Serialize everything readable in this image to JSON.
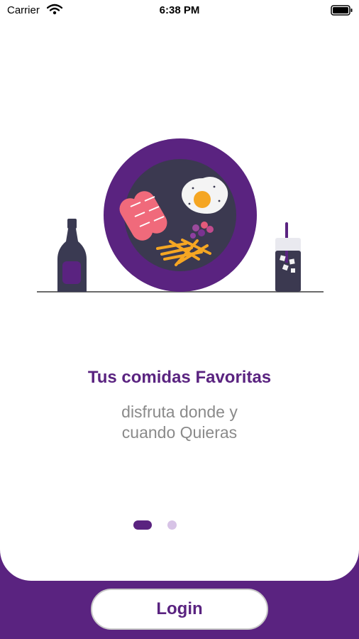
{
  "status_bar": {
    "carrier": "Carrier",
    "time": "6:38 PM"
  },
  "onboarding": {
    "title": "Tus comidas Favoritas",
    "subtitle_line1": "disfruta donde y",
    "subtitle_line2": "cuando Quieras",
    "page_count": 2,
    "current_page": 1
  },
  "login_label": "Login",
  "colors": {
    "accent": "#5a2380",
    "subtitle": "#8a8a8a",
    "inactive_dot": "#d7c3e6",
    "plate_inner": "#3b3950"
  }
}
